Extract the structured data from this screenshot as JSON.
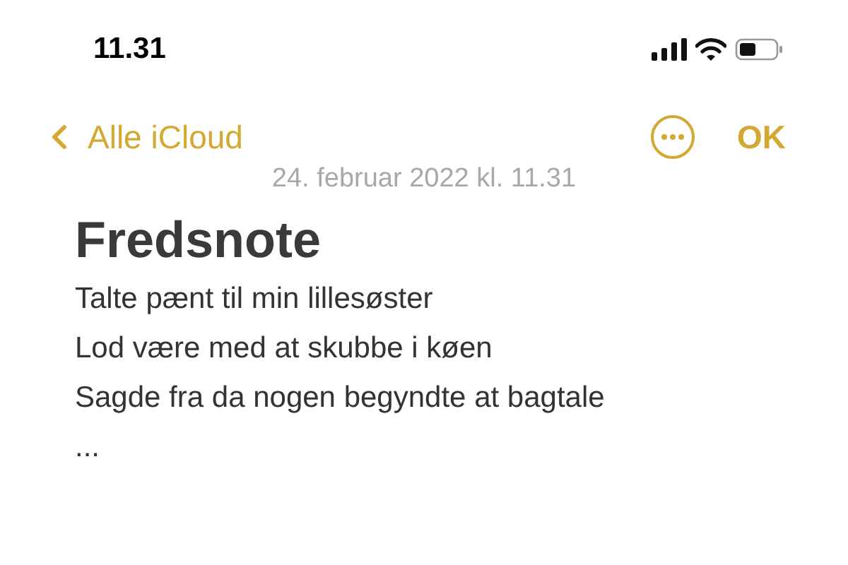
{
  "status_bar": {
    "time": "11.31"
  },
  "nav": {
    "back": "Alle iCloud",
    "done": "OK"
  },
  "note": {
    "date": "24. februar 2022 kl. 11.31",
    "title": "Fredsnote",
    "lines": [
      "Talte pænt til min lillesøster",
      "Lod være med at skubbe i køen",
      "Sagde fra da nogen begyndte at bagtale",
      "..."
    ]
  }
}
